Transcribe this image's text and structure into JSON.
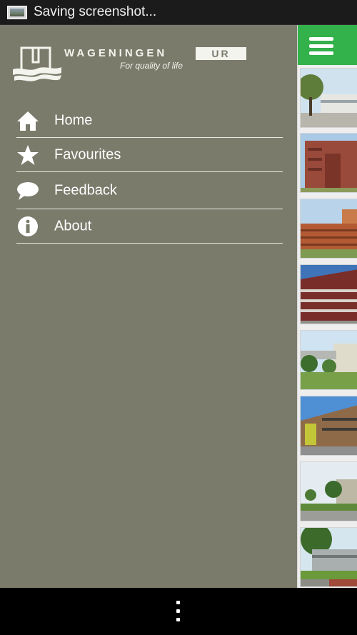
{
  "status_bar": {
    "icon": "screenshot-icon",
    "text": "Saving screenshot..."
  },
  "drawer": {
    "brand": {
      "name": "WAGENINGEN",
      "badge": "UR",
      "tagline": "For quality of life"
    },
    "menu": [
      {
        "label": "Home",
        "icon": "home-icon"
      },
      {
        "label": "Favourites",
        "icon": "star-icon"
      },
      {
        "label": "Feedback",
        "icon": "speech-bubble-icon"
      },
      {
        "label": "About",
        "icon": "info-icon"
      }
    ]
  },
  "main": {
    "menu_button_icon": "hamburger-icon",
    "thumbnail_count": 8
  },
  "nav_bar": {
    "overflow_icon": "overflow-menu-icon"
  },
  "colors": {
    "drawer_background": "#7a7b6b",
    "accent_green": "#33b14a",
    "status_bar": "#1b1b1b",
    "nav_bar": "#000000"
  }
}
